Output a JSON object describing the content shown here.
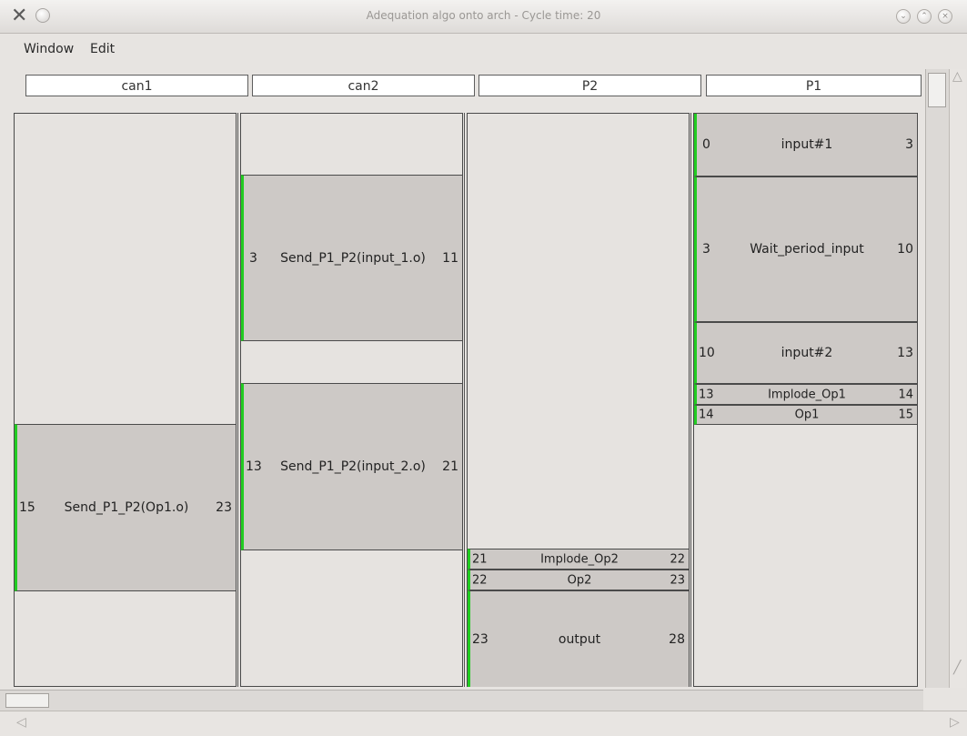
{
  "window": {
    "title": "Adequation algo onto arch - Cycle time: 20"
  },
  "menu": {
    "items": [
      "Window",
      "Edit"
    ]
  },
  "lanes": [
    {
      "name": "can1",
      "blocks": [
        {
          "start": "15",
          "name": "Send_P1_P2(Op1.o)",
          "end": "23"
        }
      ]
    },
    {
      "name": "can2",
      "blocks": [
        {
          "start": "3",
          "name": "Send_P1_P2(input_1.o)",
          "end": "11"
        },
        {
          "start": "13",
          "name": "Send_P1_P2(input_2.o)",
          "end": "21"
        }
      ]
    },
    {
      "name": "P2",
      "blocks": [
        {
          "start": "21",
          "name": "Implode_Op2",
          "end": "22"
        },
        {
          "start": "22",
          "name": "Op2",
          "end": "23"
        },
        {
          "start": "23",
          "name": "output",
          "end": "28"
        }
      ]
    },
    {
      "name": "P1",
      "blocks": [
        {
          "start": "0",
          "name": "input#1",
          "end": "3"
        },
        {
          "start": "3",
          "name": "Wait_period_input",
          "end": "10"
        },
        {
          "start": "10",
          "name": "input#2",
          "end": "13"
        },
        {
          "start": "13",
          "name": "Implode_Op1",
          "end": "14"
        },
        {
          "start": "14",
          "name": "Op1",
          "end": "15"
        }
      ]
    }
  ],
  "colors": {
    "block_fill": "#cdc9c6",
    "active_marker": "#22cc22",
    "lane_bg": "#e6e3e0"
  }
}
